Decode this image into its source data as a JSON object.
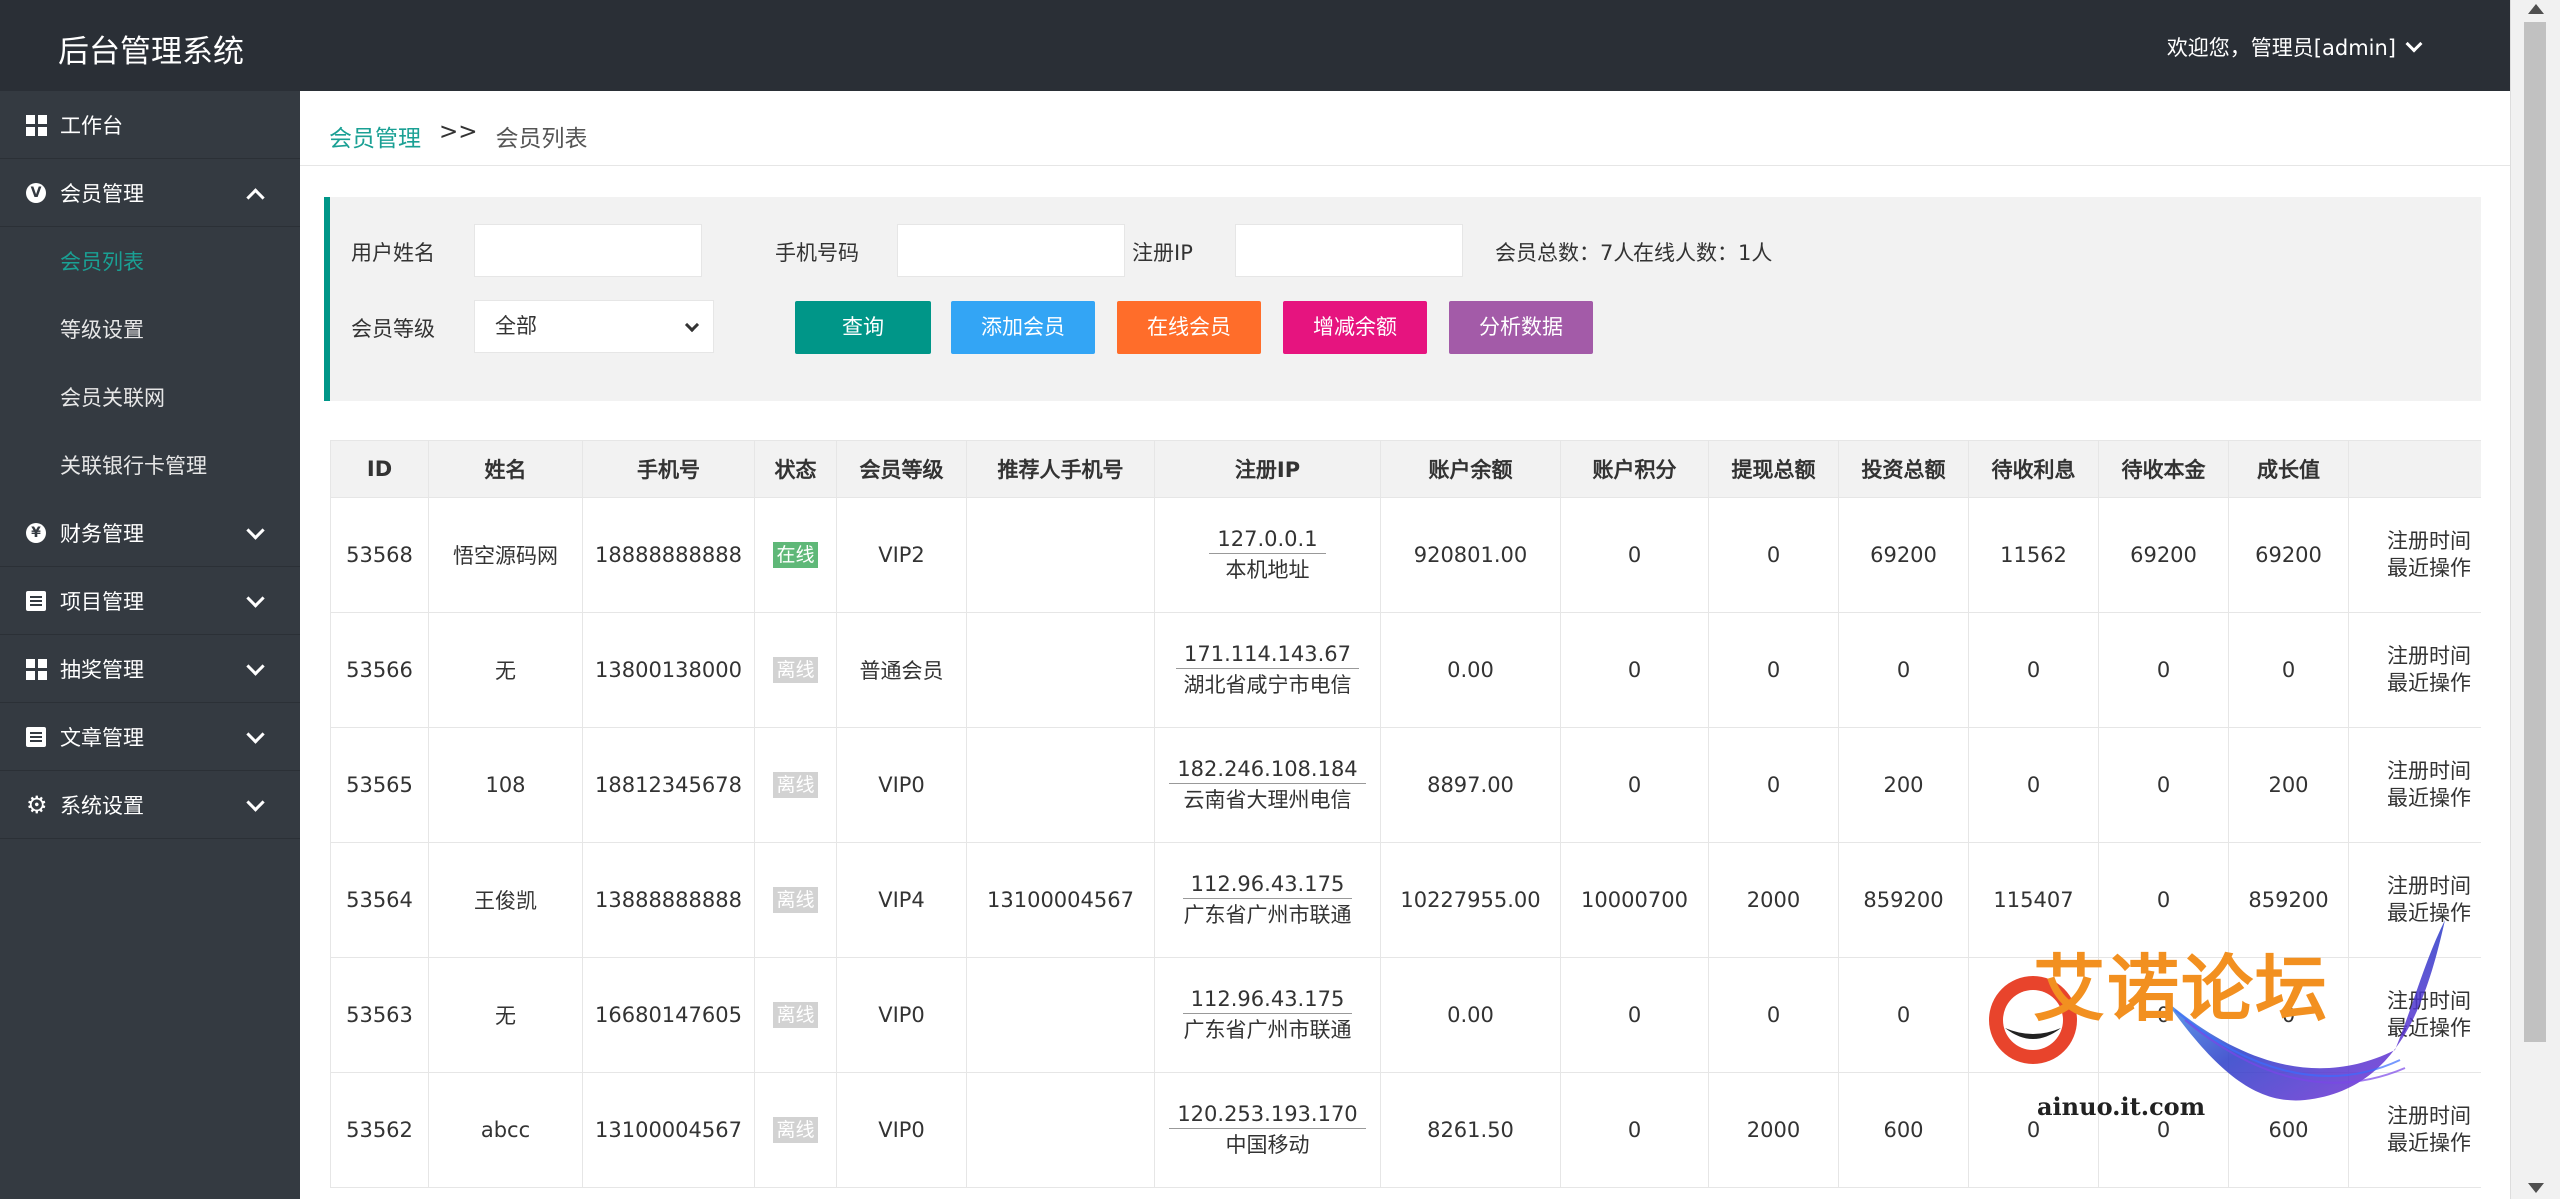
{
  "app": {
    "brand": "后台管理系统",
    "user_greeting": "欢迎您，管理员[admin]"
  },
  "sidebar": {
    "items": [
      {
        "label": "工作台",
        "icon": "dashboard-icon"
      },
      {
        "label": "会员管理",
        "icon": "member-icon",
        "expanded": true,
        "children": [
          "会员列表",
          "等级设置",
          "会员关联网",
          "关联银行卡管理"
        ]
      },
      {
        "label": "财务管理",
        "icon": "finance-icon"
      },
      {
        "label": "项目管理",
        "icon": "project-icon"
      },
      {
        "label": "抽奖管理",
        "icon": "lottery-icon"
      },
      {
        "label": "文章管理",
        "icon": "article-icon"
      },
      {
        "label": "系统设置",
        "icon": "settings-icon"
      }
    ],
    "active_child": "会员列表"
  },
  "breadcrumb": {
    "parent": "会员管理",
    "separator": ">>",
    "current": "会员列表"
  },
  "filter": {
    "username_label": "用户姓名",
    "username_value": "",
    "phone_label": "手机号码",
    "phone_value": "",
    "ip_label": "注册IP",
    "ip_value": "",
    "total_label": "会员总数：7人",
    "online_label": "在线人数：1人",
    "level_label": "会员等级",
    "level_value": "全部",
    "buttons": {
      "query": "查询",
      "add": "添加会员",
      "online": "在线会员",
      "balance": "增减余额",
      "analyze": "分析数据"
    }
  },
  "colors": {
    "topbar": "#2a2f36",
    "sidebar": "#343a41",
    "accent": "#1aa094",
    "btn_query": "#009688",
    "btn_add": "#33a5f5",
    "btn_online": "#ff6d2a",
    "btn_balance": "#e6147f",
    "btn_analyze": "#a35ba8",
    "online_badge": "#5fb878",
    "offline_badge": "#d2d2d2"
  },
  "table": {
    "headers": [
      "ID",
      "姓名",
      "手机号",
      "状态",
      "会员等级",
      "推荐人手机号",
      "注册IP",
      "账户余额",
      "账户积分",
      "提现总额",
      "投资总额",
      "待收利息",
      "待收本金",
      "成长值",
      ""
    ],
    "rows": [
      {
        "id": "53568",
        "name": "悟空源码网",
        "phone": "18888888888",
        "status": "在线",
        "online": true,
        "level": "VIP2",
        "referrer": "",
        "ip": "127.0.0.1",
        "location": "本机地址",
        "balance": "920801.00",
        "points": "0",
        "withdraw": "0",
        "invest": "69200",
        "interest": "11562",
        "principal": "69200",
        "growth": "69200",
        "op1": "注册时间",
        "op2": "最近操作"
      },
      {
        "id": "53566",
        "name": "无",
        "phone": "13800138000",
        "status": "离线",
        "online": false,
        "level": "普通会员",
        "referrer": "",
        "ip": "171.114.143.67",
        "location": "湖北省咸宁市电信",
        "balance": "0.00",
        "points": "0",
        "withdraw": "0",
        "invest": "0",
        "interest": "0",
        "principal": "0",
        "growth": "0",
        "op1": "注册时间",
        "op2": "最近操作"
      },
      {
        "id": "53565",
        "name": "108",
        "phone": "18812345678",
        "status": "离线",
        "online": false,
        "level": "VIP0",
        "referrer": "",
        "ip": "182.246.108.184",
        "location": "云南省大理州电信",
        "balance": "8897.00",
        "points": "0",
        "withdraw": "0",
        "invest": "200",
        "interest": "0",
        "principal": "0",
        "growth": "200",
        "op1": "注册时间",
        "op2": "最近操作"
      },
      {
        "id": "53564",
        "name": "王俊凯",
        "phone": "13888888888",
        "status": "离线",
        "online": false,
        "level": "VIP4",
        "referrer": "13100004567",
        "ip": "112.96.43.175",
        "location": "广东省广州市联通",
        "balance": "10227955.00",
        "points": "10000700",
        "withdraw": "2000",
        "invest": "859200",
        "interest": "115407",
        "principal": "0",
        "growth": "859200",
        "op1": "注册时间",
        "op2": "最近操作"
      },
      {
        "id": "53563",
        "name": "无",
        "phone": "16680147605",
        "status": "离线",
        "online": false,
        "level": "VIP0",
        "referrer": "",
        "ip": "112.96.43.175",
        "location": "广东省广州市联通",
        "balance": "0.00",
        "points": "0",
        "withdraw": "0",
        "invest": "0",
        "interest": "0",
        "principal": "0",
        "growth": "0",
        "op1": "注册时间",
        "op2": "最近操作"
      },
      {
        "id": "53562",
        "name": "abcc",
        "phone": "13100004567",
        "status": "离线",
        "online": false,
        "level": "VIP0",
        "referrer": "",
        "ip": "120.253.193.170",
        "location": "中国移动",
        "balance": "8261.50",
        "points": "0",
        "withdraw": "2000",
        "invest": "600",
        "interest": "0",
        "principal": "0",
        "growth": "600",
        "op1": "注册时间",
        "op2": "最近操作"
      }
    ]
  },
  "watermark": {
    "text": "艾诺论坛",
    "sub": "ainuo.it.com"
  }
}
